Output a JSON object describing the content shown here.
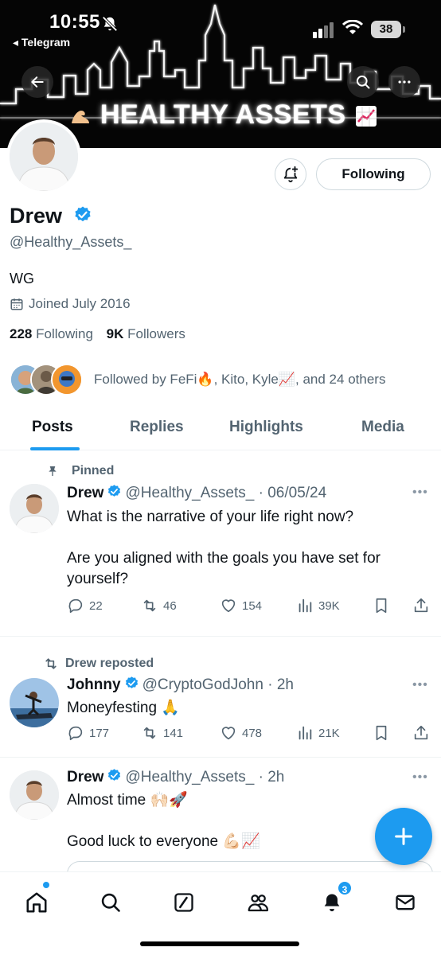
{
  "status_bar": {
    "time": "10:55",
    "back_app": "◂ Telegram",
    "battery": "38"
  },
  "banner": {
    "title": "HEALTHY ASSETS"
  },
  "profile": {
    "follow_button": "Following",
    "name": "Drew",
    "handle": "@Healthy_Assets_",
    "bio": "WG",
    "joined": "Joined July 2016",
    "following_count": "228",
    "following_label": "Following",
    "followers_count": "9K",
    "followers_label": "Followers",
    "followed_by": "Followed by FeFi🔥, Kito, Kyle📈, and 24 others"
  },
  "tabs": [
    {
      "label": "Posts"
    },
    {
      "label": "Replies"
    },
    {
      "label": "Highlights"
    },
    {
      "label": "Media"
    }
  ],
  "posts": [
    {
      "context": "Pinned",
      "name": "Drew",
      "handle": "@Healthy_Assets_",
      "time": "· 06/05/24",
      "text_lines": [
        "What is the narrative of your life right now?",
        "",
        "Are you aligned with the goals you have set for yourself?"
      ],
      "replies": "22",
      "reposts": "46",
      "likes": "154",
      "views": "39K"
    },
    {
      "context": "Drew reposted",
      "name": "Johnny",
      "handle": "@CryptoGodJohn",
      "time": "· 2h",
      "text": "Moneyfesting 🙏",
      "replies": "177",
      "reposts": "141",
      "likes": "478",
      "views": "21K"
    },
    {
      "name": "Drew",
      "handle": "@Healthy_Assets_",
      "time": "· 2h",
      "text_line1": "Almost time 🙌🏻🚀",
      "text_line2": "Good luck to everyone 💪🏻📈"
    }
  ],
  "bottom_nav": {
    "notifications_badge": "3"
  },
  "colors": {
    "accent": "#1d9bf0",
    "text_primary": "#0f1419",
    "text_secondary": "#536471"
  },
  "icons": [
    "back-arrow-icon",
    "search-icon",
    "more-icon",
    "bell-plus-icon",
    "verified-badge-icon",
    "calendar-icon",
    "pin-icon",
    "repost-icon",
    "reply-icon",
    "like-icon",
    "views-icon",
    "bookmark-icon",
    "share-icon",
    "compose-plus-icon",
    "home-icon",
    "grok-icon",
    "people-icon",
    "notifications-icon",
    "messages-icon"
  ]
}
